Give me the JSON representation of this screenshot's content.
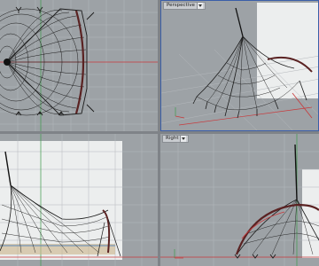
{
  "viewports": {
    "top": {
      "label": ""
    },
    "perspective": {
      "label": "Perspective"
    },
    "front": {
      "label": ""
    },
    "right": {
      "label": "Right"
    }
  },
  "colors": {
    "viewport_bg": "#9da2a6",
    "grid": "#b4b8bc",
    "axis_x": "#c8393b",
    "axis_y": "#3d9a4a",
    "mesh": "#1b1b1b",
    "active_border": "#3a5ea8",
    "backdrop": "#eceeee"
  }
}
